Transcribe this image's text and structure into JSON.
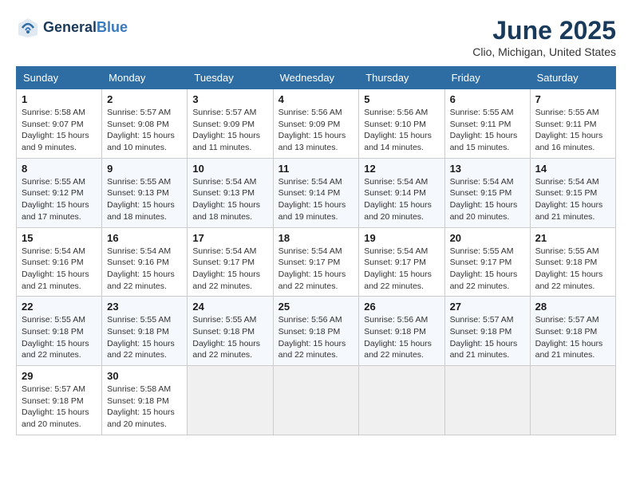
{
  "logo": {
    "line1": "General",
    "line2": "Blue"
  },
  "title": "June 2025",
  "subtitle": "Clio, Michigan, United States",
  "weekdays": [
    "Sunday",
    "Monday",
    "Tuesday",
    "Wednesday",
    "Thursday",
    "Friday",
    "Saturday"
  ],
  "weeks": [
    [
      {
        "day": "1",
        "info": "Sunrise: 5:58 AM\nSunset: 9:07 PM\nDaylight: 15 hours\nand 9 minutes."
      },
      {
        "day": "2",
        "info": "Sunrise: 5:57 AM\nSunset: 9:08 PM\nDaylight: 15 hours\nand 10 minutes."
      },
      {
        "day": "3",
        "info": "Sunrise: 5:57 AM\nSunset: 9:09 PM\nDaylight: 15 hours\nand 11 minutes."
      },
      {
        "day": "4",
        "info": "Sunrise: 5:56 AM\nSunset: 9:09 PM\nDaylight: 15 hours\nand 13 minutes."
      },
      {
        "day": "5",
        "info": "Sunrise: 5:56 AM\nSunset: 9:10 PM\nDaylight: 15 hours\nand 14 minutes."
      },
      {
        "day": "6",
        "info": "Sunrise: 5:55 AM\nSunset: 9:11 PM\nDaylight: 15 hours\nand 15 minutes."
      },
      {
        "day": "7",
        "info": "Sunrise: 5:55 AM\nSunset: 9:11 PM\nDaylight: 15 hours\nand 16 minutes."
      }
    ],
    [
      {
        "day": "8",
        "info": "Sunrise: 5:55 AM\nSunset: 9:12 PM\nDaylight: 15 hours\nand 17 minutes."
      },
      {
        "day": "9",
        "info": "Sunrise: 5:55 AM\nSunset: 9:13 PM\nDaylight: 15 hours\nand 18 minutes."
      },
      {
        "day": "10",
        "info": "Sunrise: 5:54 AM\nSunset: 9:13 PM\nDaylight: 15 hours\nand 18 minutes."
      },
      {
        "day": "11",
        "info": "Sunrise: 5:54 AM\nSunset: 9:14 PM\nDaylight: 15 hours\nand 19 minutes."
      },
      {
        "day": "12",
        "info": "Sunrise: 5:54 AM\nSunset: 9:14 PM\nDaylight: 15 hours\nand 20 minutes."
      },
      {
        "day": "13",
        "info": "Sunrise: 5:54 AM\nSunset: 9:15 PM\nDaylight: 15 hours\nand 20 minutes."
      },
      {
        "day": "14",
        "info": "Sunrise: 5:54 AM\nSunset: 9:15 PM\nDaylight: 15 hours\nand 21 minutes."
      }
    ],
    [
      {
        "day": "15",
        "info": "Sunrise: 5:54 AM\nSunset: 9:16 PM\nDaylight: 15 hours\nand 21 minutes."
      },
      {
        "day": "16",
        "info": "Sunrise: 5:54 AM\nSunset: 9:16 PM\nDaylight: 15 hours\nand 22 minutes."
      },
      {
        "day": "17",
        "info": "Sunrise: 5:54 AM\nSunset: 9:17 PM\nDaylight: 15 hours\nand 22 minutes."
      },
      {
        "day": "18",
        "info": "Sunrise: 5:54 AM\nSunset: 9:17 PM\nDaylight: 15 hours\nand 22 minutes."
      },
      {
        "day": "19",
        "info": "Sunrise: 5:54 AM\nSunset: 9:17 PM\nDaylight: 15 hours\nand 22 minutes."
      },
      {
        "day": "20",
        "info": "Sunrise: 5:55 AM\nSunset: 9:17 PM\nDaylight: 15 hours\nand 22 minutes."
      },
      {
        "day": "21",
        "info": "Sunrise: 5:55 AM\nSunset: 9:18 PM\nDaylight: 15 hours\nand 22 minutes."
      }
    ],
    [
      {
        "day": "22",
        "info": "Sunrise: 5:55 AM\nSunset: 9:18 PM\nDaylight: 15 hours\nand 22 minutes."
      },
      {
        "day": "23",
        "info": "Sunrise: 5:55 AM\nSunset: 9:18 PM\nDaylight: 15 hours\nand 22 minutes."
      },
      {
        "day": "24",
        "info": "Sunrise: 5:55 AM\nSunset: 9:18 PM\nDaylight: 15 hours\nand 22 minutes."
      },
      {
        "day": "25",
        "info": "Sunrise: 5:56 AM\nSunset: 9:18 PM\nDaylight: 15 hours\nand 22 minutes."
      },
      {
        "day": "26",
        "info": "Sunrise: 5:56 AM\nSunset: 9:18 PM\nDaylight: 15 hours\nand 22 minutes."
      },
      {
        "day": "27",
        "info": "Sunrise: 5:57 AM\nSunset: 9:18 PM\nDaylight: 15 hours\nand 21 minutes."
      },
      {
        "day": "28",
        "info": "Sunrise: 5:57 AM\nSunset: 9:18 PM\nDaylight: 15 hours\nand 21 minutes."
      }
    ],
    [
      {
        "day": "29",
        "info": "Sunrise: 5:57 AM\nSunset: 9:18 PM\nDaylight: 15 hours\nand 20 minutes."
      },
      {
        "day": "30",
        "info": "Sunrise: 5:58 AM\nSunset: 9:18 PM\nDaylight: 15 hours\nand 20 minutes."
      },
      {
        "day": "",
        "info": ""
      },
      {
        "day": "",
        "info": ""
      },
      {
        "day": "",
        "info": ""
      },
      {
        "day": "",
        "info": ""
      },
      {
        "day": "",
        "info": ""
      }
    ]
  ]
}
